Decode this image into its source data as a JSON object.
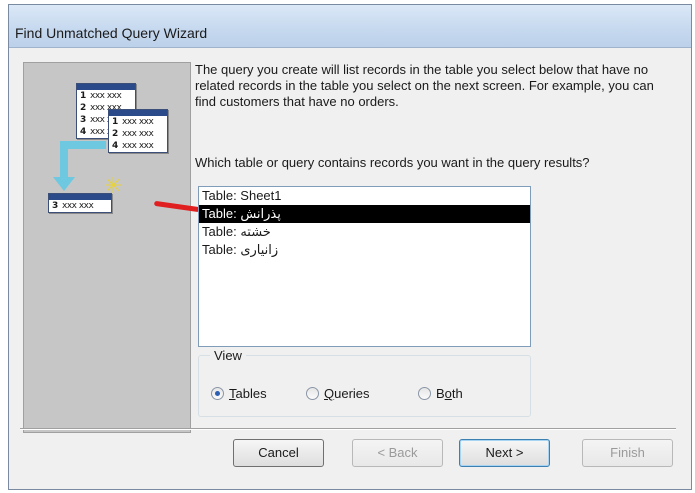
{
  "window": {
    "title": "Find Unmatched Query Wizard"
  },
  "illustration": {
    "table_a_rows": [
      {
        "num": "1",
        "val": "xxx xxx"
      },
      {
        "num": "2",
        "val": "xxx xxx"
      },
      {
        "num": "3",
        "val": "xxx xxx"
      },
      {
        "num": "4",
        "val": "xxx xxx"
      }
    ],
    "table_b_rows": [
      {
        "num": "1",
        "val": "xxx xxx"
      },
      {
        "num": "2",
        "val": "xxx xxx"
      },
      {
        "num": "4",
        "val": "xxx xxx"
      }
    ],
    "result_row": {
      "num": "3",
      "val": "xxx xxx"
    },
    "arrow_color": "#6ec8e0"
  },
  "description": "The query you create will list records in the table you select below that have no related records in the table you select on the next screen. For example, you can find customers that have no orders.",
  "question": "Which table or query contains records you want in the query results?",
  "list": {
    "items": [
      "Table: Sheet1",
      "Table: پذرانش",
      "Table: خشته",
      "Table: زانیاری"
    ],
    "selected_index": 1,
    "annotation_color": "#e02020"
  },
  "view": {
    "legend": "View",
    "options": [
      {
        "label": "Tables",
        "mnemonic": "T",
        "selected": true
      },
      {
        "label": "Queries",
        "mnemonic": "Q",
        "selected": false
      },
      {
        "label": "Both",
        "mnemonic": "o",
        "selected": false
      }
    ]
  },
  "buttons": {
    "cancel": "Cancel",
    "back": "< Back",
    "next": "Next >",
    "finish": "Finish"
  }
}
